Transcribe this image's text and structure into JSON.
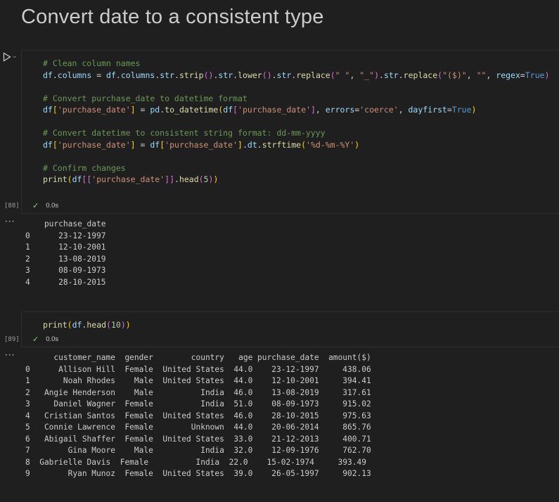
{
  "title": "Convert date to a consistent type",
  "cell1": {
    "exec_count": "[88]",
    "status_time": "0.0s",
    "lines": [
      [
        {
          "c": "c-com",
          "t": "# Clean column names"
        }
      ],
      [
        {
          "c": "c-var",
          "t": "df"
        },
        {
          "c": "c-pl",
          "t": "."
        },
        {
          "c": "c-var",
          "t": "columns"
        },
        {
          "c": "c-pl",
          "t": " = "
        },
        {
          "c": "c-var",
          "t": "df"
        },
        {
          "c": "c-pl",
          "t": "."
        },
        {
          "c": "c-var",
          "t": "columns"
        },
        {
          "c": "c-pl",
          "t": "."
        },
        {
          "c": "c-var",
          "t": "str"
        },
        {
          "c": "c-pl",
          "t": "."
        },
        {
          "c": "c-fn",
          "t": "strip"
        },
        {
          "c": "c-pun2",
          "t": "()"
        },
        {
          "c": "c-pl",
          "t": "."
        },
        {
          "c": "c-var",
          "t": "str"
        },
        {
          "c": "c-pl",
          "t": "."
        },
        {
          "c": "c-fn",
          "t": "lower"
        },
        {
          "c": "c-pun2",
          "t": "()"
        },
        {
          "c": "c-pl",
          "t": "."
        },
        {
          "c": "c-var",
          "t": "str"
        },
        {
          "c": "c-pl",
          "t": "."
        },
        {
          "c": "c-fn",
          "t": "replace"
        },
        {
          "c": "c-pun2",
          "t": "("
        },
        {
          "c": "c-str",
          "t": "\" \""
        },
        {
          "c": "c-pl",
          "t": ", "
        },
        {
          "c": "c-str",
          "t": "\"_\""
        },
        {
          "c": "c-pun2",
          "t": ")"
        },
        {
          "c": "c-pl",
          "t": "."
        },
        {
          "c": "c-var",
          "t": "str"
        },
        {
          "c": "c-pl",
          "t": "."
        },
        {
          "c": "c-fn",
          "t": "replace"
        },
        {
          "c": "c-pun2",
          "t": "("
        },
        {
          "c": "c-str",
          "t": "\"($)\""
        },
        {
          "c": "c-pl",
          "t": ", "
        },
        {
          "c": "c-str",
          "t": "\"\""
        },
        {
          "c": "c-pl",
          "t": ", "
        },
        {
          "c": "c-var",
          "t": "regex"
        },
        {
          "c": "c-pl",
          "t": "="
        },
        {
          "c": "c-kw",
          "t": "True"
        },
        {
          "c": "c-pun2",
          "t": ")"
        }
      ],
      [],
      [
        {
          "c": "c-com",
          "t": "# Convert purchase_date to datetime format"
        }
      ],
      [
        {
          "c": "c-var",
          "t": "df"
        },
        {
          "c": "c-pun",
          "t": "["
        },
        {
          "c": "c-str",
          "t": "'purchase_date'"
        },
        {
          "c": "c-pun",
          "t": "]"
        },
        {
          "c": "c-pl",
          "t": " = "
        },
        {
          "c": "c-var",
          "t": "pd"
        },
        {
          "c": "c-pl",
          "t": "."
        },
        {
          "c": "c-fn",
          "t": "to_datetime"
        },
        {
          "c": "c-pun",
          "t": "("
        },
        {
          "c": "c-var",
          "t": "df"
        },
        {
          "c": "c-pun2",
          "t": "["
        },
        {
          "c": "c-str",
          "t": "'purchase_date'"
        },
        {
          "c": "c-pun2",
          "t": "]"
        },
        {
          "c": "c-pl",
          "t": ", "
        },
        {
          "c": "c-var",
          "t": "errors"
        },
        {
          "c": "c-pl",
          "t": "="
        },
        {
          "c": "c-str",
          "t": "'coerce'"
        },
        {
          "c": "c-pl",
          "t": ", "
        },
        {
          "c": "c-var",
          "t": "dayfirst"
        },
        {
          "c": "c-pl",
          "t": "="
        },
        {
          "c": "c-kw",
          "t": "True"
        },
        {
          "c": "c-pun",
          "t": ")"
        }
      ],
      [],
      [
        {
          "c": "c-com",
          "t": "# Convert datetime to consistent string format: dd-mm-yyyy"
        }
      ],
      [
        {
          "c": "c-var",
          "t": "df"
        },
        {
          "c": "c-pun",
          "t": "["
        },
        {
          "c": "c-str",
          "t": "'purchase_date'"
        },
        {
          "c": "c-pun",
          "t": "]"
        },
        {
          "c": "c-pl",
          "t": " = "
        },
        {
          "c": "c-var",
          "t": "df"
        },
        {
          "c": "c-pun",
          "t": "["
        },
        {
          "c": "c-str",
          "t": "'purchase_date'"
        },
        {
          "c": "c-pun",
          "t": "]"
        },
        {
          "c": "c-pl",
          "t": "."
        },
        {
          "c": "c-var",
          "t": "dt"
        },
        {
          "c": "c-pl",
          "t": "."
        },
        {
          "c": "c-fn",
          "t": "strftime"
        },
        {
          "c": "c-pun",
          "t": "("
        },
        {
          "c": "c-str",
          "t": "'%d-%m-%Y'"
        },
        {
          "c": "c-pun",
          "t": ")"
        }
      ],
      [],
      [
        {
          "c": "c-com",
          "t": "# Confirm changes"
        }
      ],
      [
        {
          "c": "c-fn",
          "t": "print"
        },
        {
          "c": "c-pun",
          "t": "("
        },
        {
          "c": "c-var",
          "t": "df"
        },
        {
          "c": "c-pun2",
          "t": "[["
        },
        {
          "c": "c-str",
          "t": "'purchase_date'"
        },
        {
          "c": "c-pun2",
          "t": "]]"
        },
        {
          "c": "c-pl",
          "t": "."
        },
        {
          "c": "c-fn",
          "t": "head"
        },
        {
          "c": "c-pun2",
          "t": "("
        },
        {
          "c": "c-num",
          "t": "5"
        },
        {
          "c": "c-pun2",
          "t": ")"
        },
        {
          "c": "c-pun",
          "t": ")"
        }
      ]
    ],
    "output": "    purchase_date\n0      23-12-1997\n1      12-10-2001\n2      13-08-2019\n3      08-09-1973\n4      28-10-2015"
  },
  "cell2": {
    "exec_count": "[89]",
    "status_time": "0.0s",
    "lines": [
      [
        {
          "c": "c-fn",
          "t": "print"
        },
        {
          "c": "c-pun",
          "t": "("
        },
        {
          "c": "c-var",
          "t": "df"
        },
        {
          "c": "c-pl",
          "t": "."
        },
        {
          "c": "c-fn",
          "t": "head"
        },
        {
          "c": "c-pun2",
          "t": "("
        },
        {
          "c": "c-num",
          "t": "10"
        },
        {
          "c": "c-pun2",
          "t": ")"
        },
        {
          "c": "c-pun",
          "t": ")"
        }
      ]
    ],
    "output": "      customer_name  gender        country   age purchase_date  amount($)\n0      Allison Hill  Female  United States  44.0    23-12-1997     438.06\n1       Noah Rhodes    Male  United States  44.0    12-10-2001     394.41\n2   Angie Henderson    Male          India  46.0    13-08-2019     317.61\n3     Daniel Wagner  Female          India  51.0    08-09-1973     915.02\n4   Cristian Santos  Female  United States  46.0    28-10-2015     975.63\n5   Connie Lawrence  Female        Unknown  44.0    20-06-2014     865.76\n6   Abigail Shaffer  Female  United States  33.0    21-12-2013     400.71\n7        Gina Moore    Male          India  32.0    12-09-1976     762.70\n8  Gabrielle Davis  Female          India  22.0    15-02-1974     393.49\n9        Ryan Munoz  Female  United States  39.0    26-05-1997     902.13"
  },
  "icons": {
    "run": "play-icon",
    "collapse": "chevron-down-icon",
    "success": "check-icon",
    "more": "ellipsis-icon"
  },
  "ellipsis": "···"
}
